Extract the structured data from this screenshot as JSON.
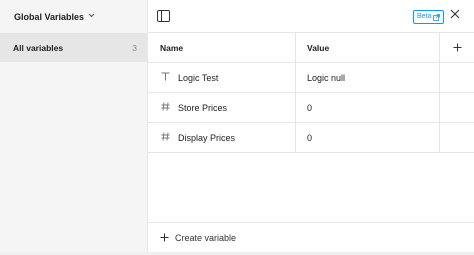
{
  "sidebar": {
    "collection_title": "Global Variables",
    "items": [
      {
        "label": "All variables",
        "count": "3"
      }
    ]
  },
  "toolbar": {
    "beta_label": "Beta"
  },
  "table": {
    "columns": [
      "Name",
      "Value"
    ],
    "rows": [
      {
        "type_icon": "text-icon",
        "name": "Logic Test",
        "value": "Logic null"
      },
      {
        "type_icon": "number-icon",
        "name": "Store Prices",
        "value": "0"
      },
      {
        "type_icon": "number-icon",
        "name": "Display Prices",
        "value": "0"
      }
    ]
  },
  "footer": {
    "create_label": "Create variable"
  },
  "colors": {
    "accent": "#0d99ff",
    "sidebar_bg": "#f5f5f5",
    "selected_bg": "#e6e6e6"
  }
}
